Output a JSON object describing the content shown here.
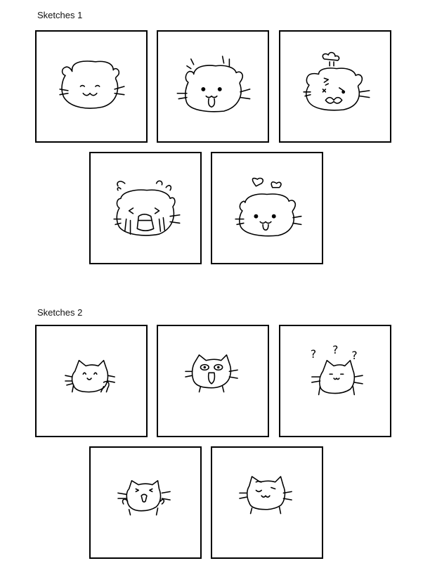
{
  "sections": [
    {
      "title": "Sketches 1",
      "sketches": [
        {
          "subject": "hamster",
          "expression": "smug-smile-icon"
        },
        {
          "subject": "hamster",
          "expression": "surprised-icon"
        },
        {
          "subject": "hamster",
          "expression": "angry-steam-icon"
        },
        {
          "subject": "hamster",
          "expression": "crying-icon"
        },
        {
          "subject": "hamster",
          "expression": "love-hearts-icon"
        }
      ]
    },
    {
      "title": "Sketches 2",
      "sketches": [
        {
          "subject": "cat",
          "expression": "happy-wave-icon"
        },
        {
          "subject": "cat",
          "expression": "shocked-icon"
        },
        {
          "subject": "cat",
          "expression": "confused-icon"
        },
        {
          "subject": "cat",
          "expression": "cheering-icon"
        },
        {
          "subject": "cat",
          "expression": "wink-icon"
        }
      ]
    }
  ]
}
